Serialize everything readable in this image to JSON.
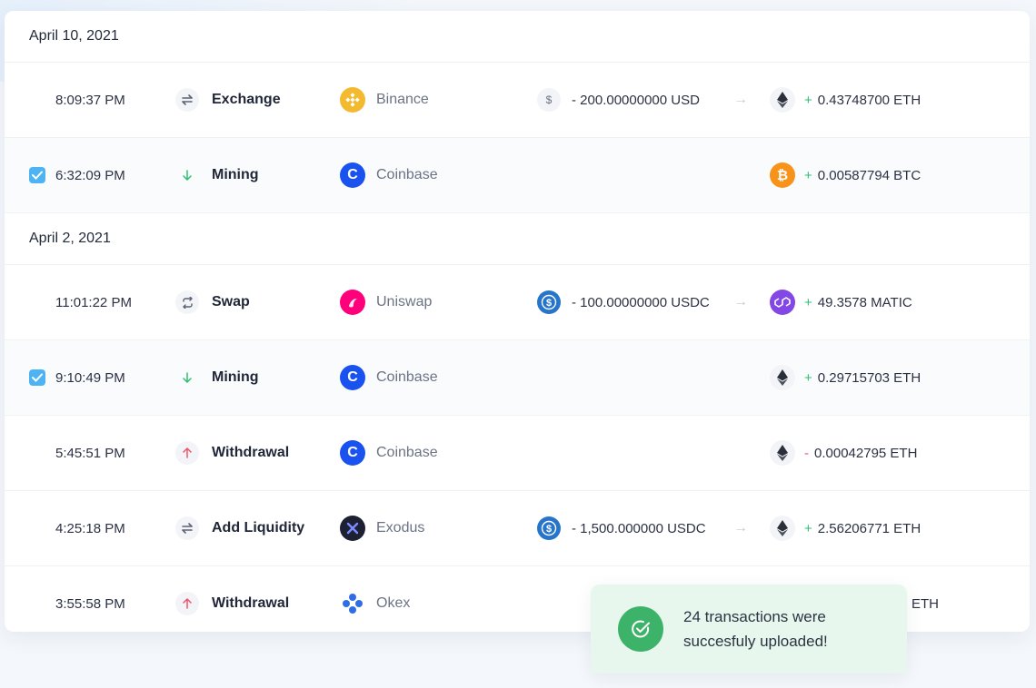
{
  "groups": [
    {
      "date": "April 10, 2021",
      "rows": [
        {
          "time": "8:09:37 PM",
          "type": "Exchange",
          "exchange": "Binance",
          "from": "- 200.00000000 USD",
          "sign": "+",
          "to": "0.43748700 ETH",
          "checked": false
        },
        {
          "time": "6:32:09 PM",
          "type": "Mining",
          "exchange": "Coinbase",
          "from": "",
          "sign": "+",
          "to": "0.00587794 BTC",
          "checked": true
        }
      ]
    },
    {
      "date": "April 2, 2021",
      "rows": [
        {
          "time": "11:01:22 PM",
          "type": "Swap",
          "exchange": "Uniswap",
          "from": "- 100.00000000 USDC",
          "sign": "+",
          "to": "49.3578 MATIC",
          "checked": false
        },
        {
          "time": "9:10:49 PM",
          "type": "Mining",
          "exchange": "Coinbase",
          "from": "",
          "sign": "+",
          "to": "0.29715703 ETH",
          "checked": true
        },
        {
          "time": "5:45:51 PM",
          "type": "Withdrawal",
          "exchange": "Coinbase",
          "from": "",
          "sign": "-",
          "to": "0.00042795 ETH",
          "checked": false
        },
        {
          "time": "4:25:18 PM",
          "type": "Add Liquidity",
          "exchange": "Exodus",
          "from": "- 1,500.000000 USDC",
          "sign": "+",
          "to": "2.56206771 ETH",
          "checked": false
        },
        {
          "time": "3:55:58 PM",
          "type": "Withdrawal",
          "exchange": "Okex",
          "from": "",
          "sign": "",
          "to": "ETH",
          "checked": false
        }
      ]
    }
  ],
  "toast": {
    "line1": "24 transactions were",
    "line2": "succesfuly uploaded!"
  },
  "colors": {
    "accent_check": "#4db3f3",
    "positive": "#2fbf71",
    "negative": "#f0546a",
    "toast_bg": "#e8f7ee",
    "toast_icon": "#3db36a"
  }
}
